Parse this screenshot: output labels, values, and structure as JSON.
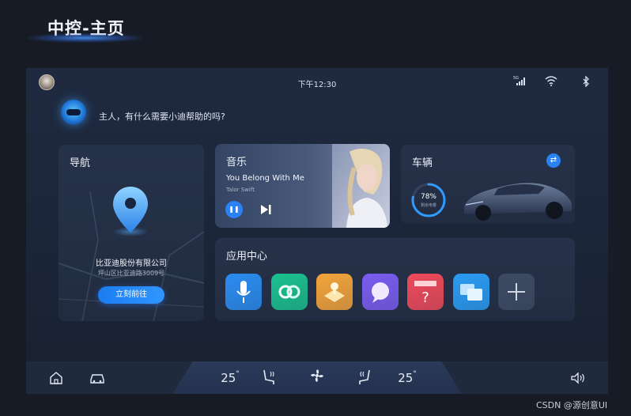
{
  "page": {
    "heading": "中控-主页"
  },
  "status_bar": {
    "time": "下午12:30",
    "signal_label": "5G"
  },
  "assistant": {
    "greeting": "主人，有什么需要小迪帮助的吗?"
  },
  "navigation": {
    "title": "导航",
    "poi_name": "比亚迪股份有限公司",
    "poi_address": "坪山区比亚迪路3009号",
    "go_label": "立刻前往"
  },
  "music": {
    "title": "音乐",
    "song": "You Belong With Me",
    "artist": "Talor Swift",
    "pause_symbol": "❚❚"
  },
  "vehicle": {
    "title": "车辆",
    "battery_percent": "78%",
    "battery_fraction": 0.78,
    "battery_label": "剩余电量",
    "switch_symbol": "⇄"
  },
  "apps": {
    "title": "应用中心",
    "items": [
      {
        "icon": "microphone-icon",
        "color": "#2a8cf0"
      },
      {
        "icon": "link-icon",
        "color": "#1bc08f"
      },
      {
        "icon": "game-icon",
        "color": "#f3a43a"
      },
      {
        "icon": "chat-icon",
        "color": "#7a5cf0"
      },
      {
        "icon": "help-card-icon",
        "color": "#ef4a5a"
      },
      {
        "icon": "screen-cast-icon",
        "color": "#2a9cf4"
      },
      {
        "icon": "plus-icon",
        "color": "#3d4a63"
      }
    ]
  },
  "dock": {
    "temp_left": "25",
    "temp_right": "25",
    "degree": "°"
  },
  "watermark": "CSDN @源创意UI"
}
